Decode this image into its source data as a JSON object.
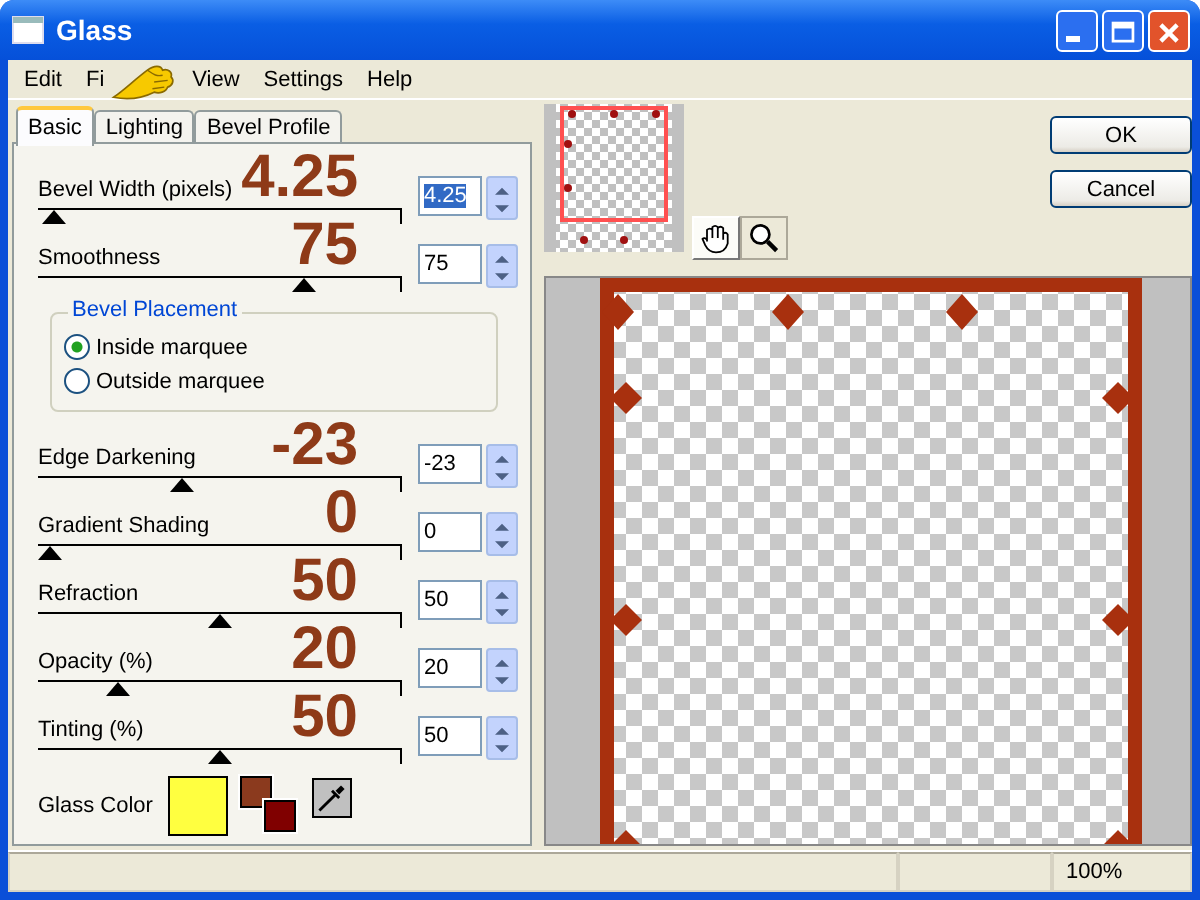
{
  "window": {
    "title": "Glass"
  },
  "menu": [
    {
      "label": "Edit"
    },
    {
      "label": "Fi"
    },
    {
      "label": "View"
    },
    {
      "label": "Settings"
    },
    {
      "label": "Help"
    }
  ],
  "tabs": [
    {
      "label": "Basic",
      "selected": true
    },
    {
      "label": "Lighting",
      "selected": false
    },
    {
      "label": "Bevel Profile",
      "selected": false
    }
  ],
  "sliders_top": [
    {
      "label": "Bevel Width (pixels)",
      "value": "4.25",
      "level": 0.01,
      "annotation": "4.25",
      "text_selected": true
    },
    {
      "label": "Smoothness",
      "value": "75",
      "level": 0.75,
      "annotation": "75",
      "text_selected": false
    }
  ],
  "bevel_placement": {
    "title": "Bevel Placement",
    "options": [
      {
        "label": "Inside marquee",
        "selected": true
      },
      {
        "label": "Outside marquee",
        "selected": false
      }
    ]
  },
  "sliders_bottom": [
    {
      "label": "Edge Darkening",
      "value": "-23",
      "level": 0.39,
      "annotation": "-23",
      "text_selected": false
    },
    {
      "label": "Gradient Shading",
      "value": "0",
      "level": 0,
      "annotation": "0",
      "text_selected": false
    },
    {
      "label": "Refraction",
      "value": "50",
      "level": 0.5,
      "annotation": "50",
      "text_selected": false
    },
    {
      "label": "Opacity (%)",
      "value": "20",
      "level": 0.2,
      "annotation": "20",
      "text_selected": false
    },
    {
      "label": "Tinting (%)",
      "value": "50",
      "level": 0.5,
      "annotation": "50",
      "text_selected": false
    }
  ],
  "glass_color": {
    "label": "Glass Color",
    "swatches": [
      {
        "kind": "glass",
        "color": "#ffff40"
      },
      {
        "kind": "foreground",
        "color": "#8b3a1e"
      },
      {
        "kind": "background",
        "color": "#800000"
      }
    ]
  },
  "tools": [
    {
      "kind": "pan",
      "selected": true
    },
    {
      "kind": "zoom",
      "selected": false
    }
  ],
  "buttons": [
    "OK",
    "Cancel"
  ],
  "status_bar": {
    "zoom": "100%"
  }
}
